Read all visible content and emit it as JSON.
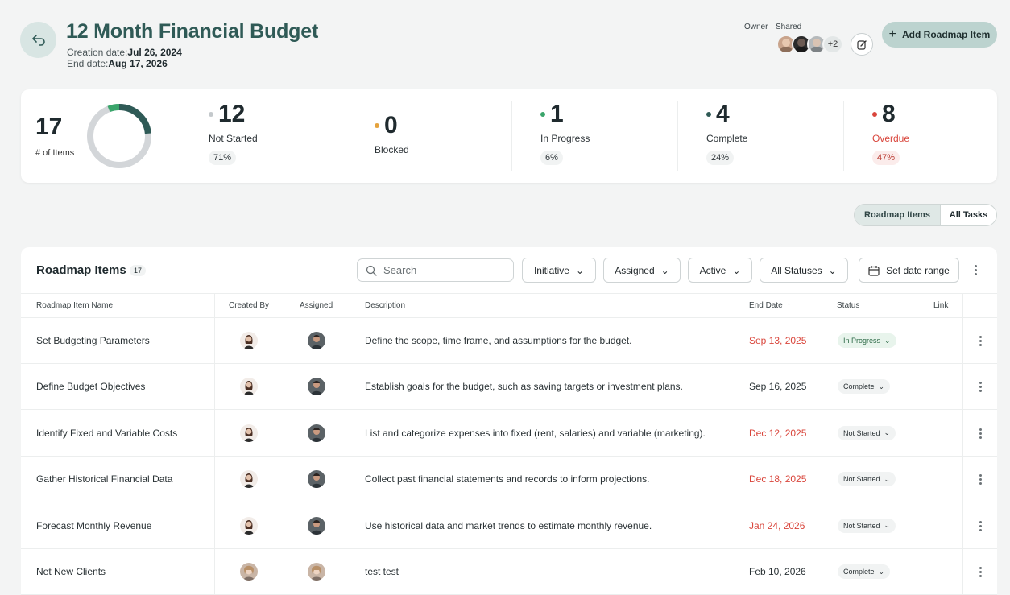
{
  "header": {
    "title": "12 Month Financial Budget",
    "creation_label": "Creation date:",
    "creation_value": "Jul 26, 2024",
    "end_label": "End date:",
    "end_value": "Aug 17, 2026",
    "owner_label": "Owner",
    "shared_label": "Shared",
    "shared_more": "+2",
    "add_button": "Add Roadmap Item"
  },
  "stats": {
    "total": "17",
    "total_label": "# of Items",
    "items": [
      {
        "num": "12",
        "label": "Not Started",
        "pct": "71%",
        "dot": "#c4c9cc"
      },
      {
        "num": "0",
        "label": "Blocked",
        "pct": "",
        "dot": "#e5a33d"
      },
      {
        "num": "1",
        "label": "In Progress",
        "pct": "6%",
        "dot": "#3aa56b"
      },
      {
        "num": "4",
        "label": "Complete",
        "pct": "24%",
        "dot": "#2f5a56"
      },
      {
        "num": "8",
        "label": "Overdue",
        "pct": "47%",
        "dot": "#d9453b"
      }
    ]
  },
  "view_toggle": {
    "active": "Roadmap Items",
    "other": "All Tasks"
  },
  "table": {
    "title": "Roadmap Items",
    "count": "17",
    "search_placeholder": "Search",
    "filters": [
      "Initiative",
      "Assigned",
      "Active",
      "All Statuses"
    ],
    "date_range": "Set date range",
    "columns": [
      "Roadmap Item Name",
      "Created By",
      "Assigned",
      "Description",
      "End Date",
      "Status",
      "Link"
    ],
    "rows": [
      {
        "name": "Set Budgeting Parameters",
        "desc": "Define the scope, time frame, and assumptions for the budget.",
        "end": "Sep 13, 2025",
        "overdue": true,
        "status": "In Progress"
      },
      {
        "name": "Define Budget Objectives",
        "desc": "Establish goals for the budget, such as saving targets or investment plans.",
        "end": "Sep 16, 2025",
        "overdue": false,
        "status": "Complete"
      },
      {
        "name": "Identify Fixed and Variable Costs",
        "desc": "List and categorize expenses into fixed (rent, salaries) and variable (marketing).",
        "end": "Dec 12, 2025",
        "overdue": true,
        "status": "Not Started"
      },
      {
        "name": "Gather Historical Financial Data",
        "desc": "Collect past financial statements and records to inform projections.",
        "end": "Dec 18, 2025",
        "overdue": true,
        "status": "Not Started"
      },
      {
        "name": "Forecast Monthly Revenue",
        "desc": "Use historical data and market trends to estimate monthly revenue.",
        "end": "Jan 24, 2026",
        "overdue": true,
        "status": "Not Started"
      },
      {
        "name": "Net New Clients",
        "desc": "test test",
        "end": "Feb 10, 2026",
        "overdue": false,
        "status": "Complete"
      }
    ]
  },
  "colors": {
    "accent": "#2f5a56",
    "overdue": "#d9453b",
    "add_button_bg": "#bcd3cf"
  }
}
